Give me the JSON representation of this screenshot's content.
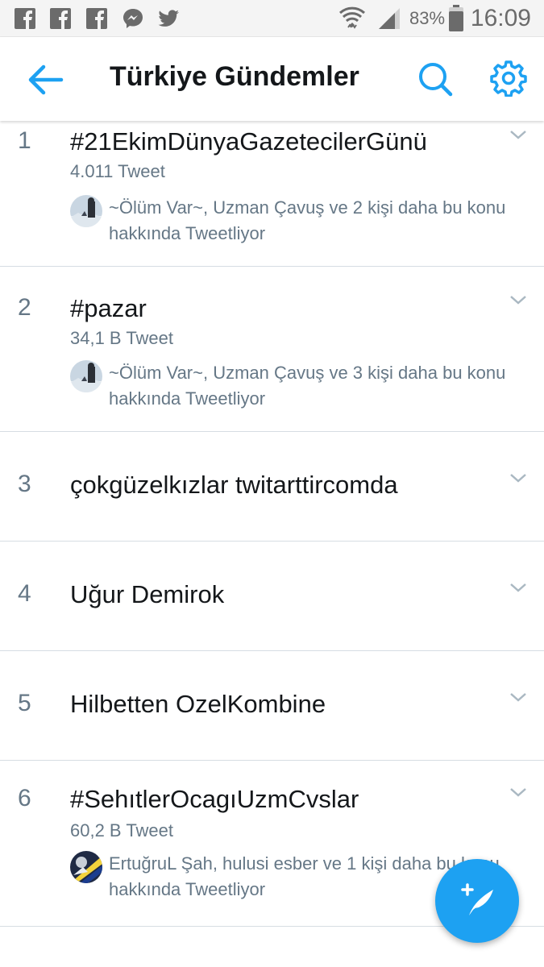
{
  "status_bar": {
    "battery_percent": "83%",
    "time": "16:09",
    "notification_icons": [
      "facebook-icon",
      "facebook-icon",
      "facebook-icon",
      "messenger-icon",
      "twitter-icon"
    ],
    "battery_level": 0.83
  },
  "header": {
    "title": "Türkiye Gündemler",
    "accent_color": "#1da1f2"
  },
  "trends": [
    {
      "rank": "1",
      "name": "#21EkimDünyaGazetecilerGünü",
      "count": "4.011 Tweet",
      "context": "~Ölüm Var~, Uzman Çavuş ve 2 kişi daha bu konu hakkında Tweetliyor"
    },
    {
      "rank": "2",
      "name": "#pazar",
      "count": "34,1 B Tweet",
      "context": "~Ölüm Var~, Uzman Çavuş ve 3 kişi daha bu konu hakkında Tweetliyor"
    },
    {
      "rank": "3",
      "name": "çokgüzelkızlar twitarttircomda"
    },
    {
      "rank": "4",
      "name": "Uğur Demirok"
    },
    {
      "rank": "5",
      "name": "Hilbetten OzelKombine"
    },
    {
      "rank": "6",
      "name": "#SehıtlerOcagıUzmCvslar",
      "count": "60,2 B Tweet",
      "context": "ErtuğruL Şah, hulusi esber ve 1 kişi daha bu konu hakkında Tweetliyor"
    }
  ]
}
